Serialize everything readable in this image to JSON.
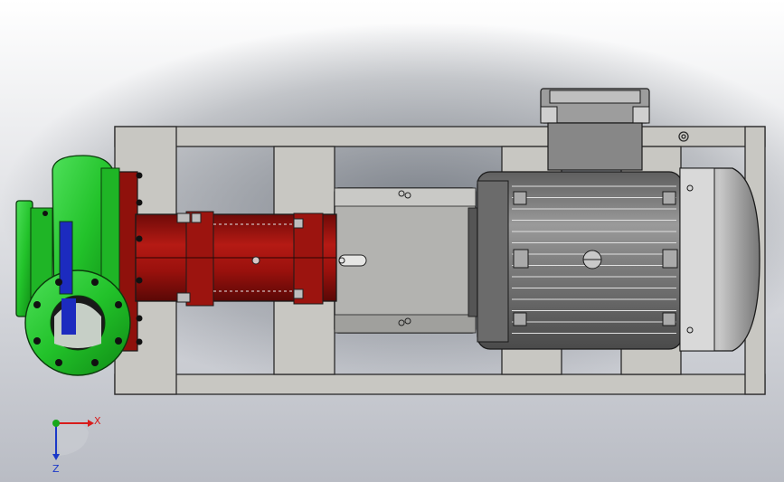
{
  "viewport": {
    "background_top": "#ffffff",
    "background_bottom": "#b9bcc4",
    "shadow_color": "#6a7079"
  },
  "colors": {
    "frame_fill": "#c8c7c2",
    "frame_stroke": "#2a2a2a",
    "pump_green": "#22c22a",
    "pump_green_dark": "#0d7a12",
    "bracket_red": "#a8140f",
    "bracket_red_dark": "#6e0a08",
    "motor_gray": "#8d8d8d",
    "motor_gray_light": "#bdbdbd",
    "coupling_guard": "#b3b3b0",
    "axis_x": "#d81b1b",
    "axis_y": "#18a81a",
    "axis_z": "#1a38c8"
  },
  "axis_triad": {
    "x_label": "X",
    "z_label": "Z"
  },
  "icons": [
    "axis-triad-icon"
  ]
}
